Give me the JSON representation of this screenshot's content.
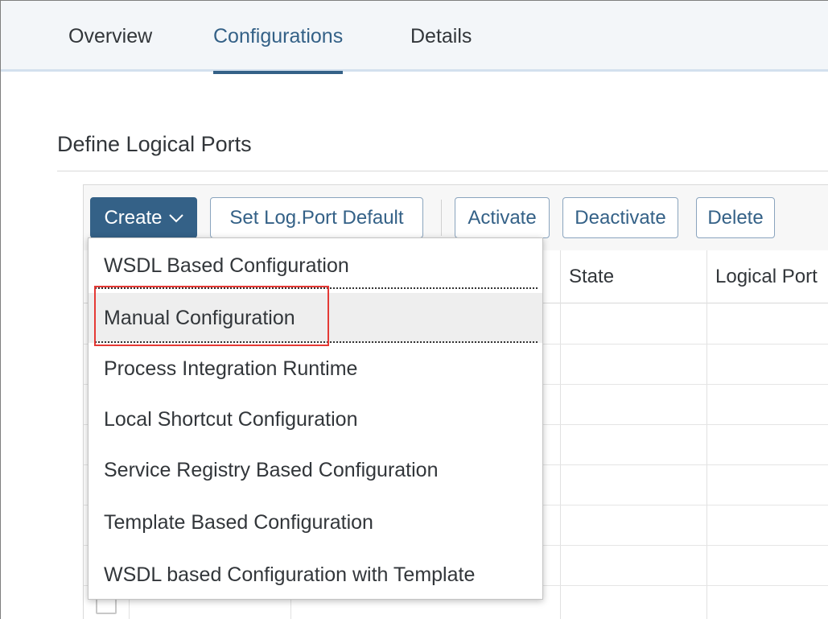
{
  "tabs": [
    {
      "label": "Overview"
    },
    {
      "label": "Configurations"
    },
    {
      "label": "Details"
    }
  ],
  "section": {
    "title": "Define Logical Ports"
  },
  "toolbar": {
    "create_label": "Create",
    "set_default_label": "Set Log.Port Default",
    "activate_label": "Activate",
    "deactivate_label": "Deactivate",
    "delete_label": "Delete"
  },
  "table": {
    "columns": [
      "State",
      "Logical Port"
    ]
  },
  "menu": {
    "items": [
      "WSDL Based Configuration",
      "Manual Configuration",
      "Process Integration Runtime",
      "Local Shortcut Configuration",
      "Service Registry Based Configuration",
      "Template Based Configuration",
      "WSDL based Configuration with Template"
    ],
    "hovered": "Manual Configuration"
  },
  "colors": {
    "accent": "#346187",
    "highlight": "#e53935"
  }
}
